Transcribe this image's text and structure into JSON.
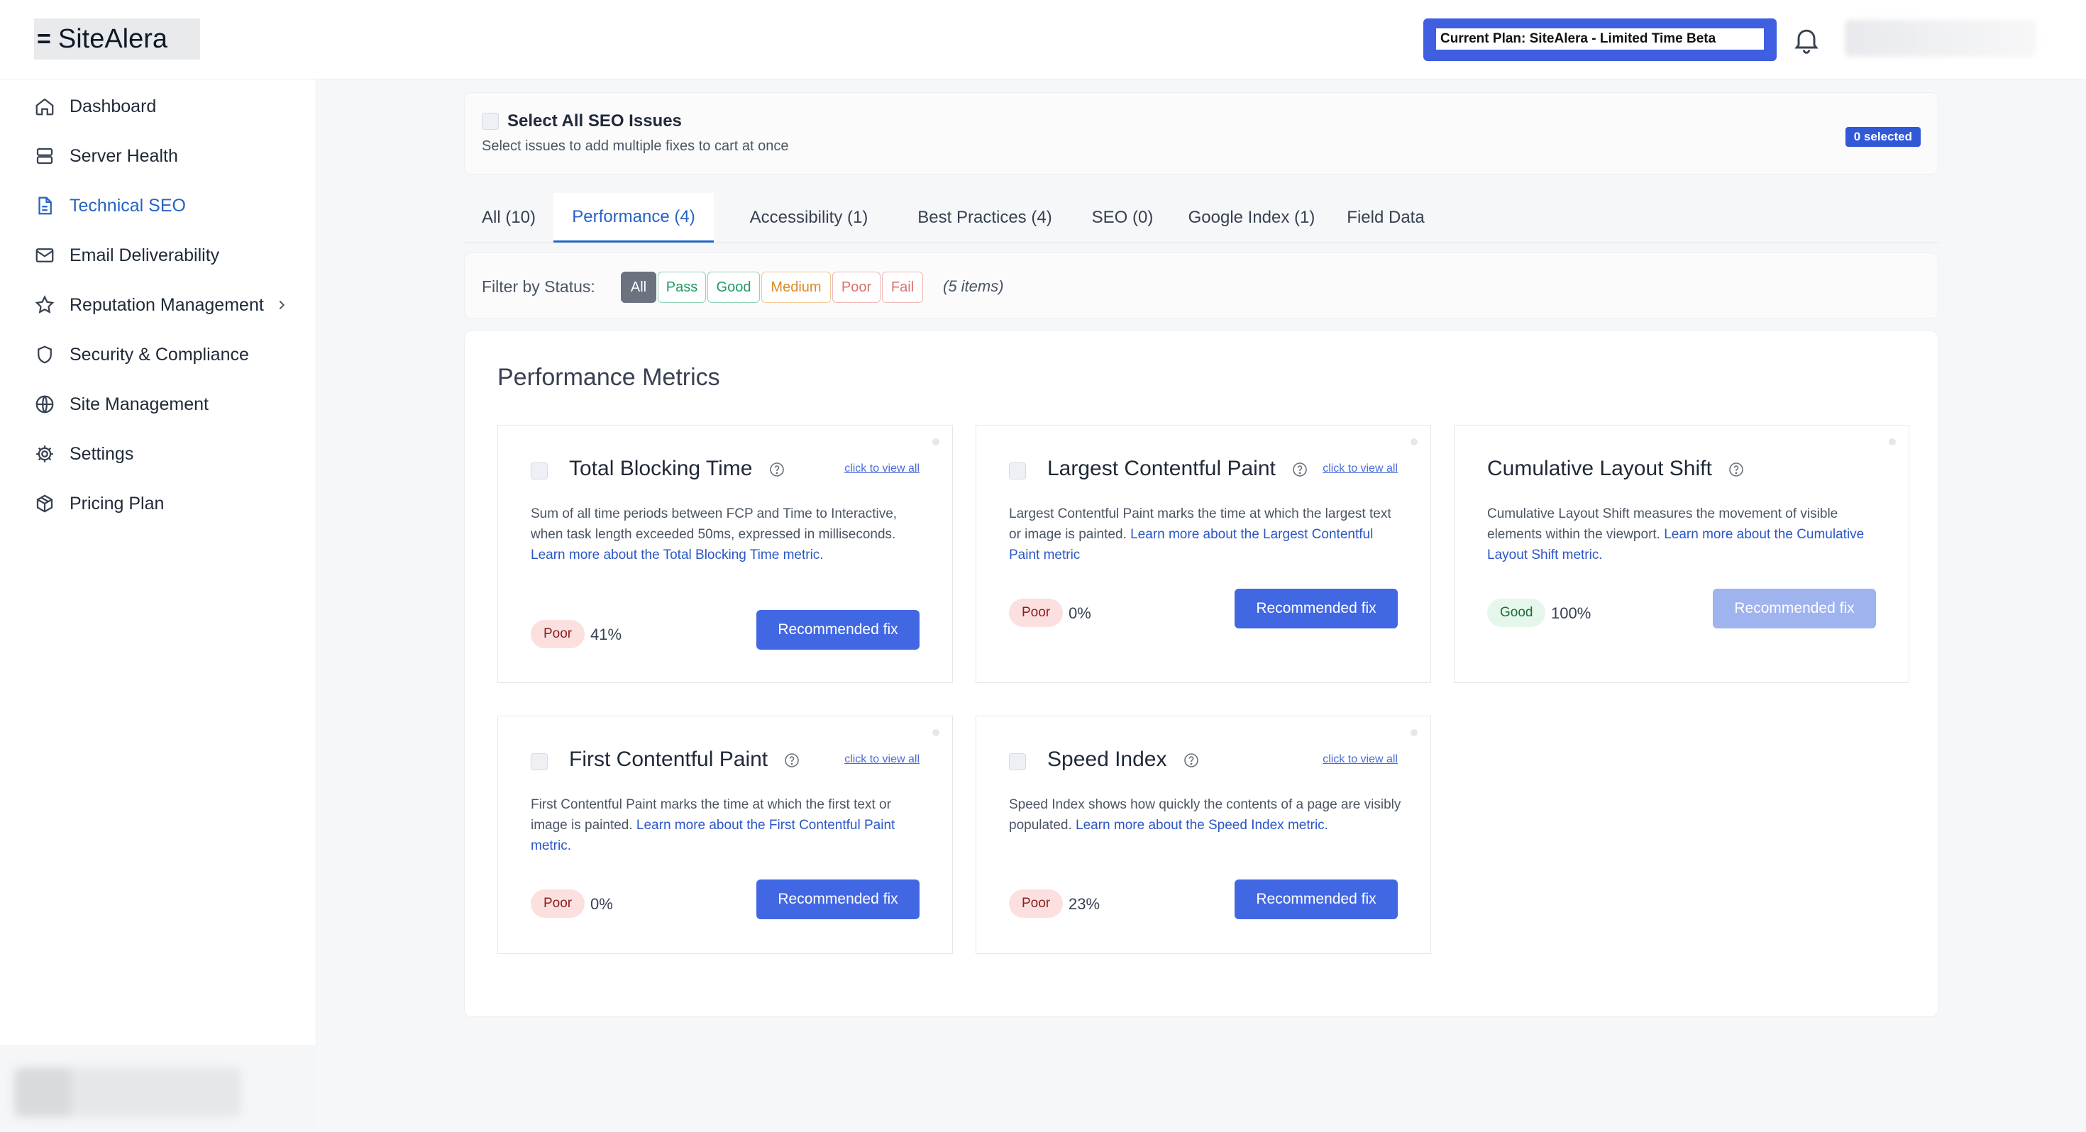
{
  "brand": {
    "name": "SiteAlera",
    "glyph": "="
  },
  "header": {
    "plan_label": "Current Plan: SiteAlera - Limited Time Beta"
  },
  "sidebar": {
    "items": [
      {
        "label": "Dashboard",
        "icon": "home-icon"
      },
      {
        "label": "Server Health",
        "icon": "server-icon"
      },
      {
        "label": "Technical SEO",
        "icon": "document-icon",
        "active": true
      },
      {
        "label": "Email Deliverability",
        "icon": "mail-icon"
      },
      {
        "label": "Reputation Management",
        "icon": "star-icon",
        "has_chevron": true
      },
      {
        "label": "Security & Compliance",
        "icon": "shield-icon"
      },
      {
        "label": "Site Management",
        "icon": "globe-icon"
      },
      {
        "label": "Settings",
        "icon": "gear-icon"
      },
      {
        "label": "Pricing Plan",
        "icon": "package-icon"
      }
    ]
  },
  "select_all": {
    "title": "Select All SEO Issues",
    "subtitle": "Select issues to add multiple fixes to cart at once",
    "selected_badge": "0 selected"
  },
  "tabs": [
    {
      "label": "All (10)"
    },
    {
      "label": "Performance (4)",
      "active": true
    },
    {
      "label": "Accessibility (1)"
    },
    {
      "label": "Best Practices (4)"
    },
    {
      "label": "SEO (0)"
    },
    {
      "label": "Google Index (1)"
    },
    {
      "label": "Field Data"
    }
  ],
  "filter": {
    "label": "Filter by Status:",
    "options": [
      "All",
      "Pass",
      "Good",
      "Medium",
      "Poor",
      "Fail"
    ],
    "selected": "All",
    "count_text": "(5 items)",
    "colors": {
      "all": "#6b7280",
      "pass": "#1e9a64",
      "good": "#1e9a64",
      "medium": "#d98a2b",
      "poor": "#d9706f",
      "fail": "#d9706f"
    }
  },
  "metrics": {
    "title": "Performance Metrics",
    "view_all_label": "click to view all",
    "fix_label": "Recommended fix",
    "cards": [
      {
        "title": "Total Blocking Time",
        "desc": "Sum of all time periods between FCP and Time to Interactive, when task length exceeded 50ms, expressed in milliseconds. ",
        "link": "Learn more about the Total Blocking Time metric.",
        "status": "Poor",
        "score": "41%"
      },
      {
        "title": "Largest Contentful Paint",
        "desc": "Largest Contentful Paint marks the time at which the largest text or image is painted. ",
        "link": "Learn more about the Largest Contentful Paint metric",
        "status": "Poor",
        "score": "0%"
      },
      {
        "title": "Cumulative Layout Shift",
        "desc": "Cumulative Layout Shift measures the movement of visible elements within the viewport. ",
        "link": "Learn more about the Cumulative Layout Shift metric.",
        "status": "Good",
        "score": "100%"
      },
      {
        "title": "First Contentful Paint",
        "desc": "First Contentful Paint marks the time at which the first text or image is painted. ",
        "link": "Learn more about the First Contentful Paint metric.",
        "status": "Poor",
        "score": "0%"
      },
      {
        "title": "Speed Index",
        "desc": "Speed Index shows how quickly the contents of a page are visibly populated. ",
        "link": "Learn more about the Speed Index metric.",
        "status": "Poor",
        "score": "23%"
      }
    ]
  }
}
